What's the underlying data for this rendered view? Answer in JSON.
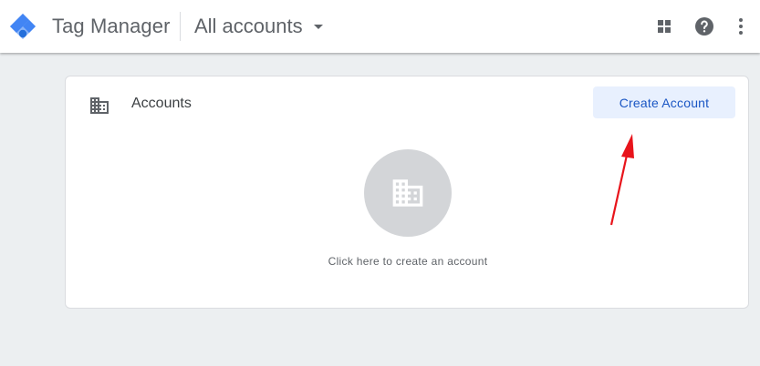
{
  "header": {
    "app_title": "Tag Manager",
    "account_selector": "All accounts",
    "icons": [
      "tag-manager-logo",
      "caret-down-icon",
      "apps-grid-icon",
      "help-icon",
      "more-vert-icon"
    ]
  },
  "accounts_card": {
    "title": "Accounts",
    "create_button": "Create Account",
    "empty_state_text": "Click here to create an account",
    "icons": [
      "building-icon",
      "building-icon"
    ]
  },
  "colors": {
    "brand_blue": "#4285f4",
    "button_bg": "#e8f0fe",
    "button_text": "#1a56c4",
    "annotation_arrow": "#e8141b",
    "background": "#eceff1"
  }
}
